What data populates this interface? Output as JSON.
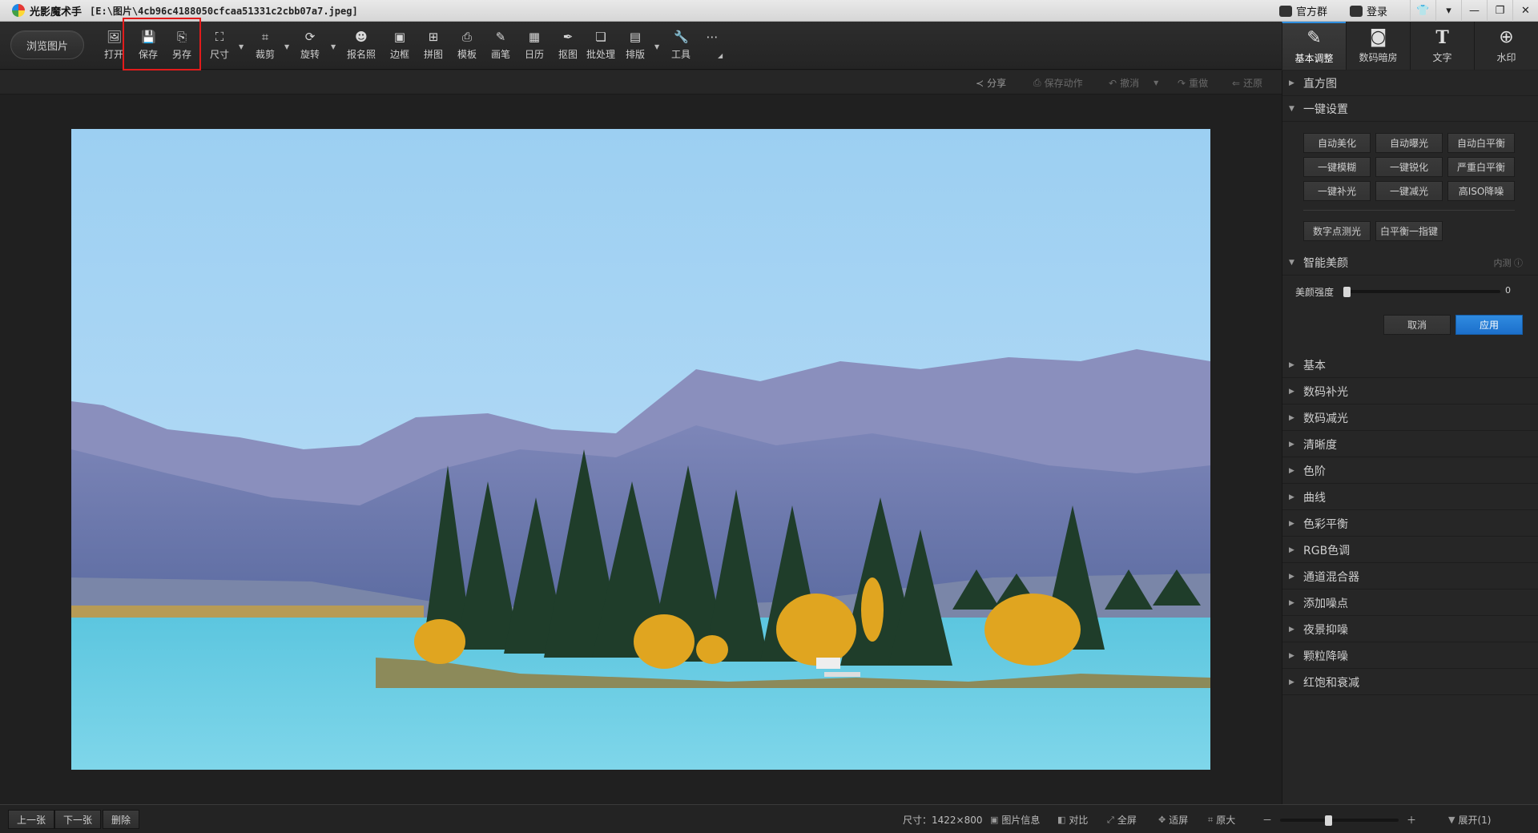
{
  "titlebar": {
    "app_name": "光影魔术手",
    "file_path": "[E:\\图片\\4cb96c4188050cfcaa51331c2cbb07a7.jpeg]",
    "links": [
      {
        "label": "官方群",
        "icon": "group-icon"
      },
      {
        "label": "登录",
        "icon": "login-icon"
      }
    ],
    "window_buttons": [
      "skin-icon",
      "menu-icon",
      "minimize-icon",
      "restore-icon",
      "close-icon"
    ]
  },
  "toolbar": {
    "browse_label": "浏览图片",
    "tools": [
      {
        "label": "打开",
        "icon": "open-icon"
      },
      {
        "label": "保存",
        "icon": "save-icon"
      },
      {
        "label": "另存",
        "icon": "save-as-icon"
      },
      {
        "label": "尺寸",
        "icon": "resize-icon"
      },
      {
        "label": "裁剪",
        "icon": "crop-icon"
      },
      {
        "label": "旋转",
        "icon": "rotate-icon"
      },
      {
        "label": "报名照",
        "icon": "id-photo-icon"
      },
      {
        "label": "边框",
        "icon": "border-icon"
      },
      {
        "label": "拼图",
        "icon": "collage-icon"
      },
      {
        "label": "模板",
        "icon": "template-icon"
      },
      {
        "label": "画笔",
        "icon": "brush-icon"
      },
      {
        "label": "日历",
        "icon": "calendar-icon"
      },
      {
        "label": "抠图",
        "icon": "cutout-icon"
      },
      {
        "label": "批处理",
        "icon": "batch-icon"
      },
      {
        "label": "排版",
        "icon": "layout-icon"
      },
      {
        "label": "工具",
        "icon": "wrench-icon"
      },
      {
        "label": "",
        "icon": "more-icon"
      }
    ]
  },
  "right_tabs": [
    {
      "label": "基本调整",
      "icon": "edit-icon",
      "active": true
    },
    {
      "label": "数码暗房",
      "icon": "camera-icon",
      "active": false
    },
    {
      "label": "文字",
      "icon": "text-icon",
      "active": false
    },
    {
      "label": "水印",
      "icon": "watermark-icon",
      "active": false
    }
  ],
  "actions": [
    {
      "label": "分享",
      "icon": "share-icon",
      "enabled": true
    },
    {
      "label": "保存动作",
      "icon": "save-action-icon",
      "enabled": false
    },
    {
      "label": "撤消",
      "icon": "undo-icon",
      "enabled": false
    },
    {
      "label": "重做",
      "icon": "redo-icon",
      "enabled": false
    },
    {
      "label": "还原",
      "icon": "revert-icon",
      "enabled": false
    }
  ],
  "panel": {
    "histogram": "直方图",
    "one_click": {
      "title": "一键设置",
      "buttons": [
        "自动美化",
        "自动曝光",
        "自动白平衡",
        "一键模糊",
        "一键锐化",
        "严重白平衡",
        "一键补光",
        "一键减光",
        "高ISO降噪"
      ],
      "extra_buttons": [
        "数字点测光",
        "白平衡一指键"
      ]
    },
    "beauty": {
      "title": "智能美颜",
      "extra": "内测",
      "slider_label": "美颜强度",
      "slider_value": "0",
      "cancel": "取消",
      "apply": "应用"
    },
    "sections": [
      "基本",
      "数码补光",
      "数码减光",
      "清晰度",
      "色阶",
      "曲线",
      "色彩平衡",
      "RGB色调",
      "通道混合器",
      "添加噪点",
      "夜景抑噪",
      "颗粒降噪",
      "红饱和衰减"
    ]
  },
  "statusbar": {
    "prev": "上一张",
    "next": "下一张",
    "delete": "删除",
    "size": "尺寸：1422×800",
    "items": [
      {
        "label": "图片信息",
        "icon": "info-icon"
      },
      {
        "label": "对比",
        "icon": "compare-icon"
      },
      {
        "label": "全屏",
        "icon": "fullscreen-icon"
      },
      {
        "label": "适屏",
        "icon": "fit-screen-icon"
      },
      {
        "label": "原大",
        "icon": "actual-size-icon"
      }
    ],
    "zoom_minus": "－",
    "zoom_plus": "＋",
    "zoom_level": 0.4,
    "expand": "展开(1)"
  }
}
